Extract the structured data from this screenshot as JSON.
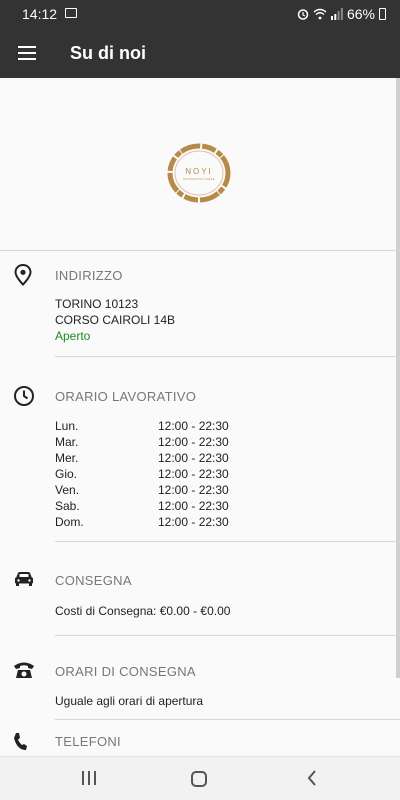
{
  "status": {
    "time": "14:12",
    "battery": "66%"
  },
  "app_bar": {
    "title": "Su di noi"
  },
  "logo": {
    "text": "NOYI",
    "subtext": "RISTORANTE CINESE"
  },
  "address": {
    "title": "INDIRIZZO",
    "line1": "TORINO 10123",
    "line2": "CORSO CAIROLI 14B",
    "status": "Aperto"
  },
  "hours": {
    "title": "ORARIO LAVORATIVO",
    "rows": [
      {
        "day": "Lun.",
        "time": "12:00 - 22:30"
      },
      {
        "day": "Mar.",
        "time": "12:00 - 22:30"
      },
      {
        "day": "Mer.",
        "time": "12:00 - 22:30"
      },
      {
        "day": "Gio.",
        "time": "12:00 - 22:30"
      },
      {
        "day": "Ven.",
        "time": "12:00 - 22:30"
      },
      {
        "day": "Sab.",
        "time": "12:00 - 22:30"
      },
      {
        "day": "Dom.",
        "time": "12:00 - 22:30"
      }
    ]
  },
  "delivery": {
    "title": "CONSEGNA",
    "cost": "Costi di Consegna: €0.00 - €0.00"
  },
  "delivery_hours": {
    "title": "ORARI DI CONSEGNA",
    "text": "Uguale agli orari di apertura"
  },
  "phones": {
    "title": "TELEFONI"
  },
  "colors": {
    "app_bar": "#333333",
    "open_status": "#1e8a1e",
    "logo": "#b58a4a"
  }
}
